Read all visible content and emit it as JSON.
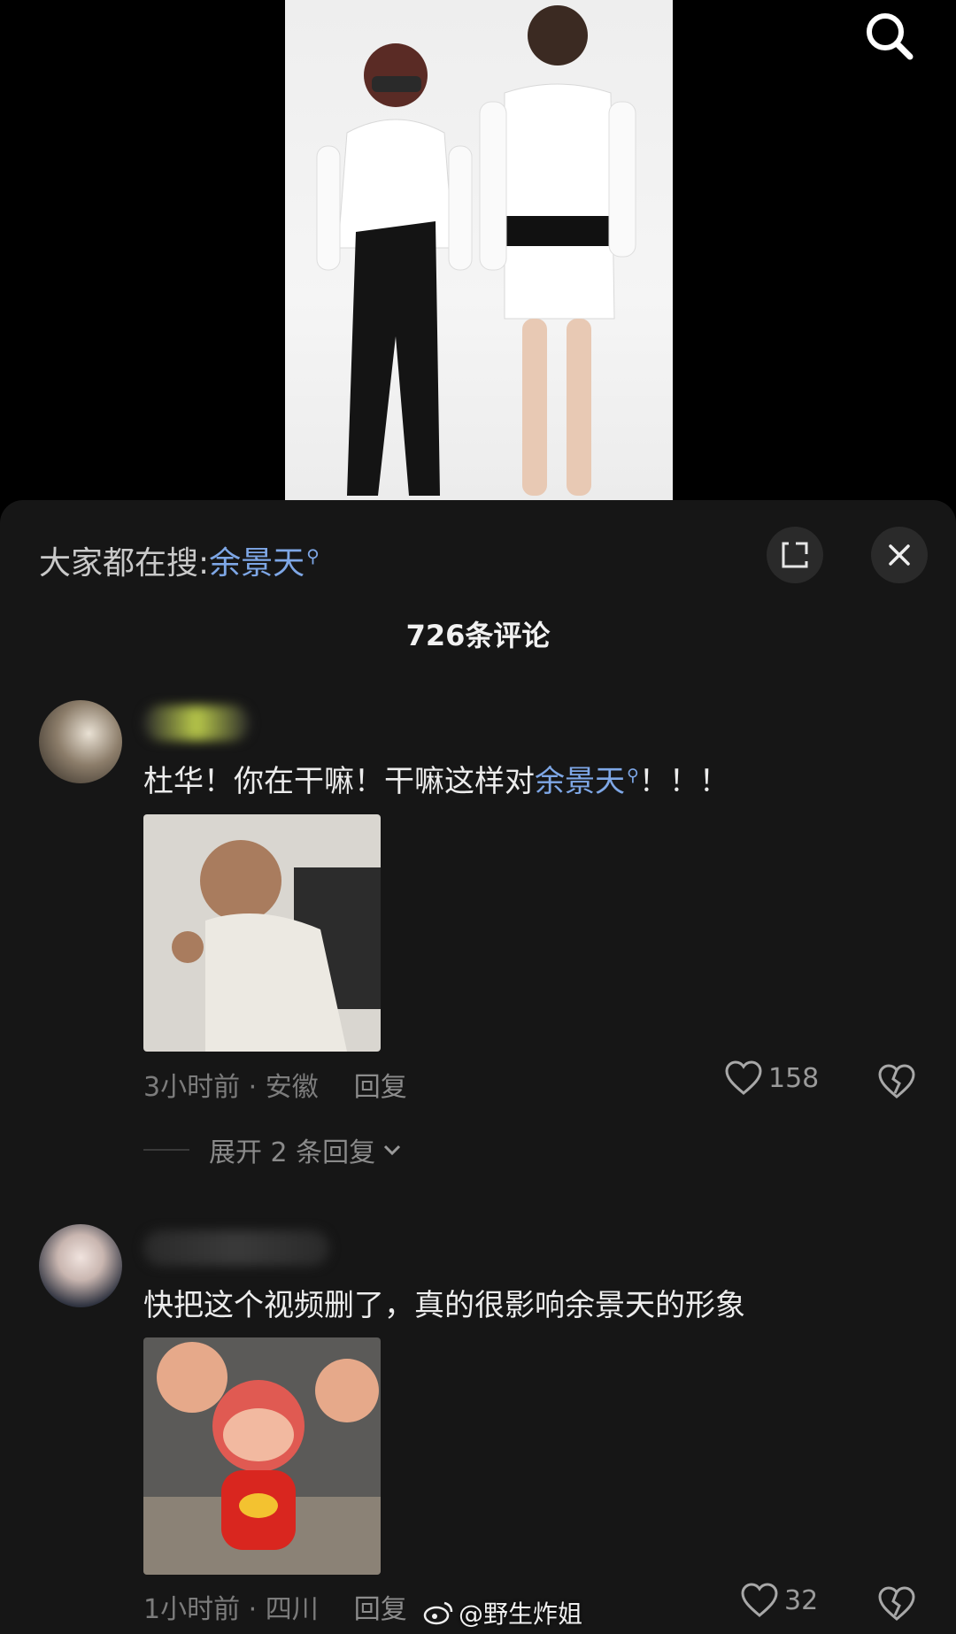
{
  "trending": {
    "prefix": "大家都在搜:",
    "keyword": "余景天"
  },
  "comment_count": "726条评论",
  "comments": [
    {
      "text_before": "杜华！你在干嘛！干嘛这样对",
      "keyword": "余景天",
      "text_after": "！！！",
      "meta": "3小时前 · 安徽",
      "reply_label": "回复",
      "likes": "158",
      "expand_label": "展开 2 条回复"
    },
    {
      "text": "快把这个视频删了，真的很影响余景天的形象",
      "meta": "1小时前 · 四川",
      "reply_label": "回复",
      "likes": "32"
    }
  ],
  "watermark": "@野生炸姐",
  "colors": {
    "keyword": "#7ea7e6",
    "sheet_bg": "#161616",
    "page_bg": "#000000"
  }
}
